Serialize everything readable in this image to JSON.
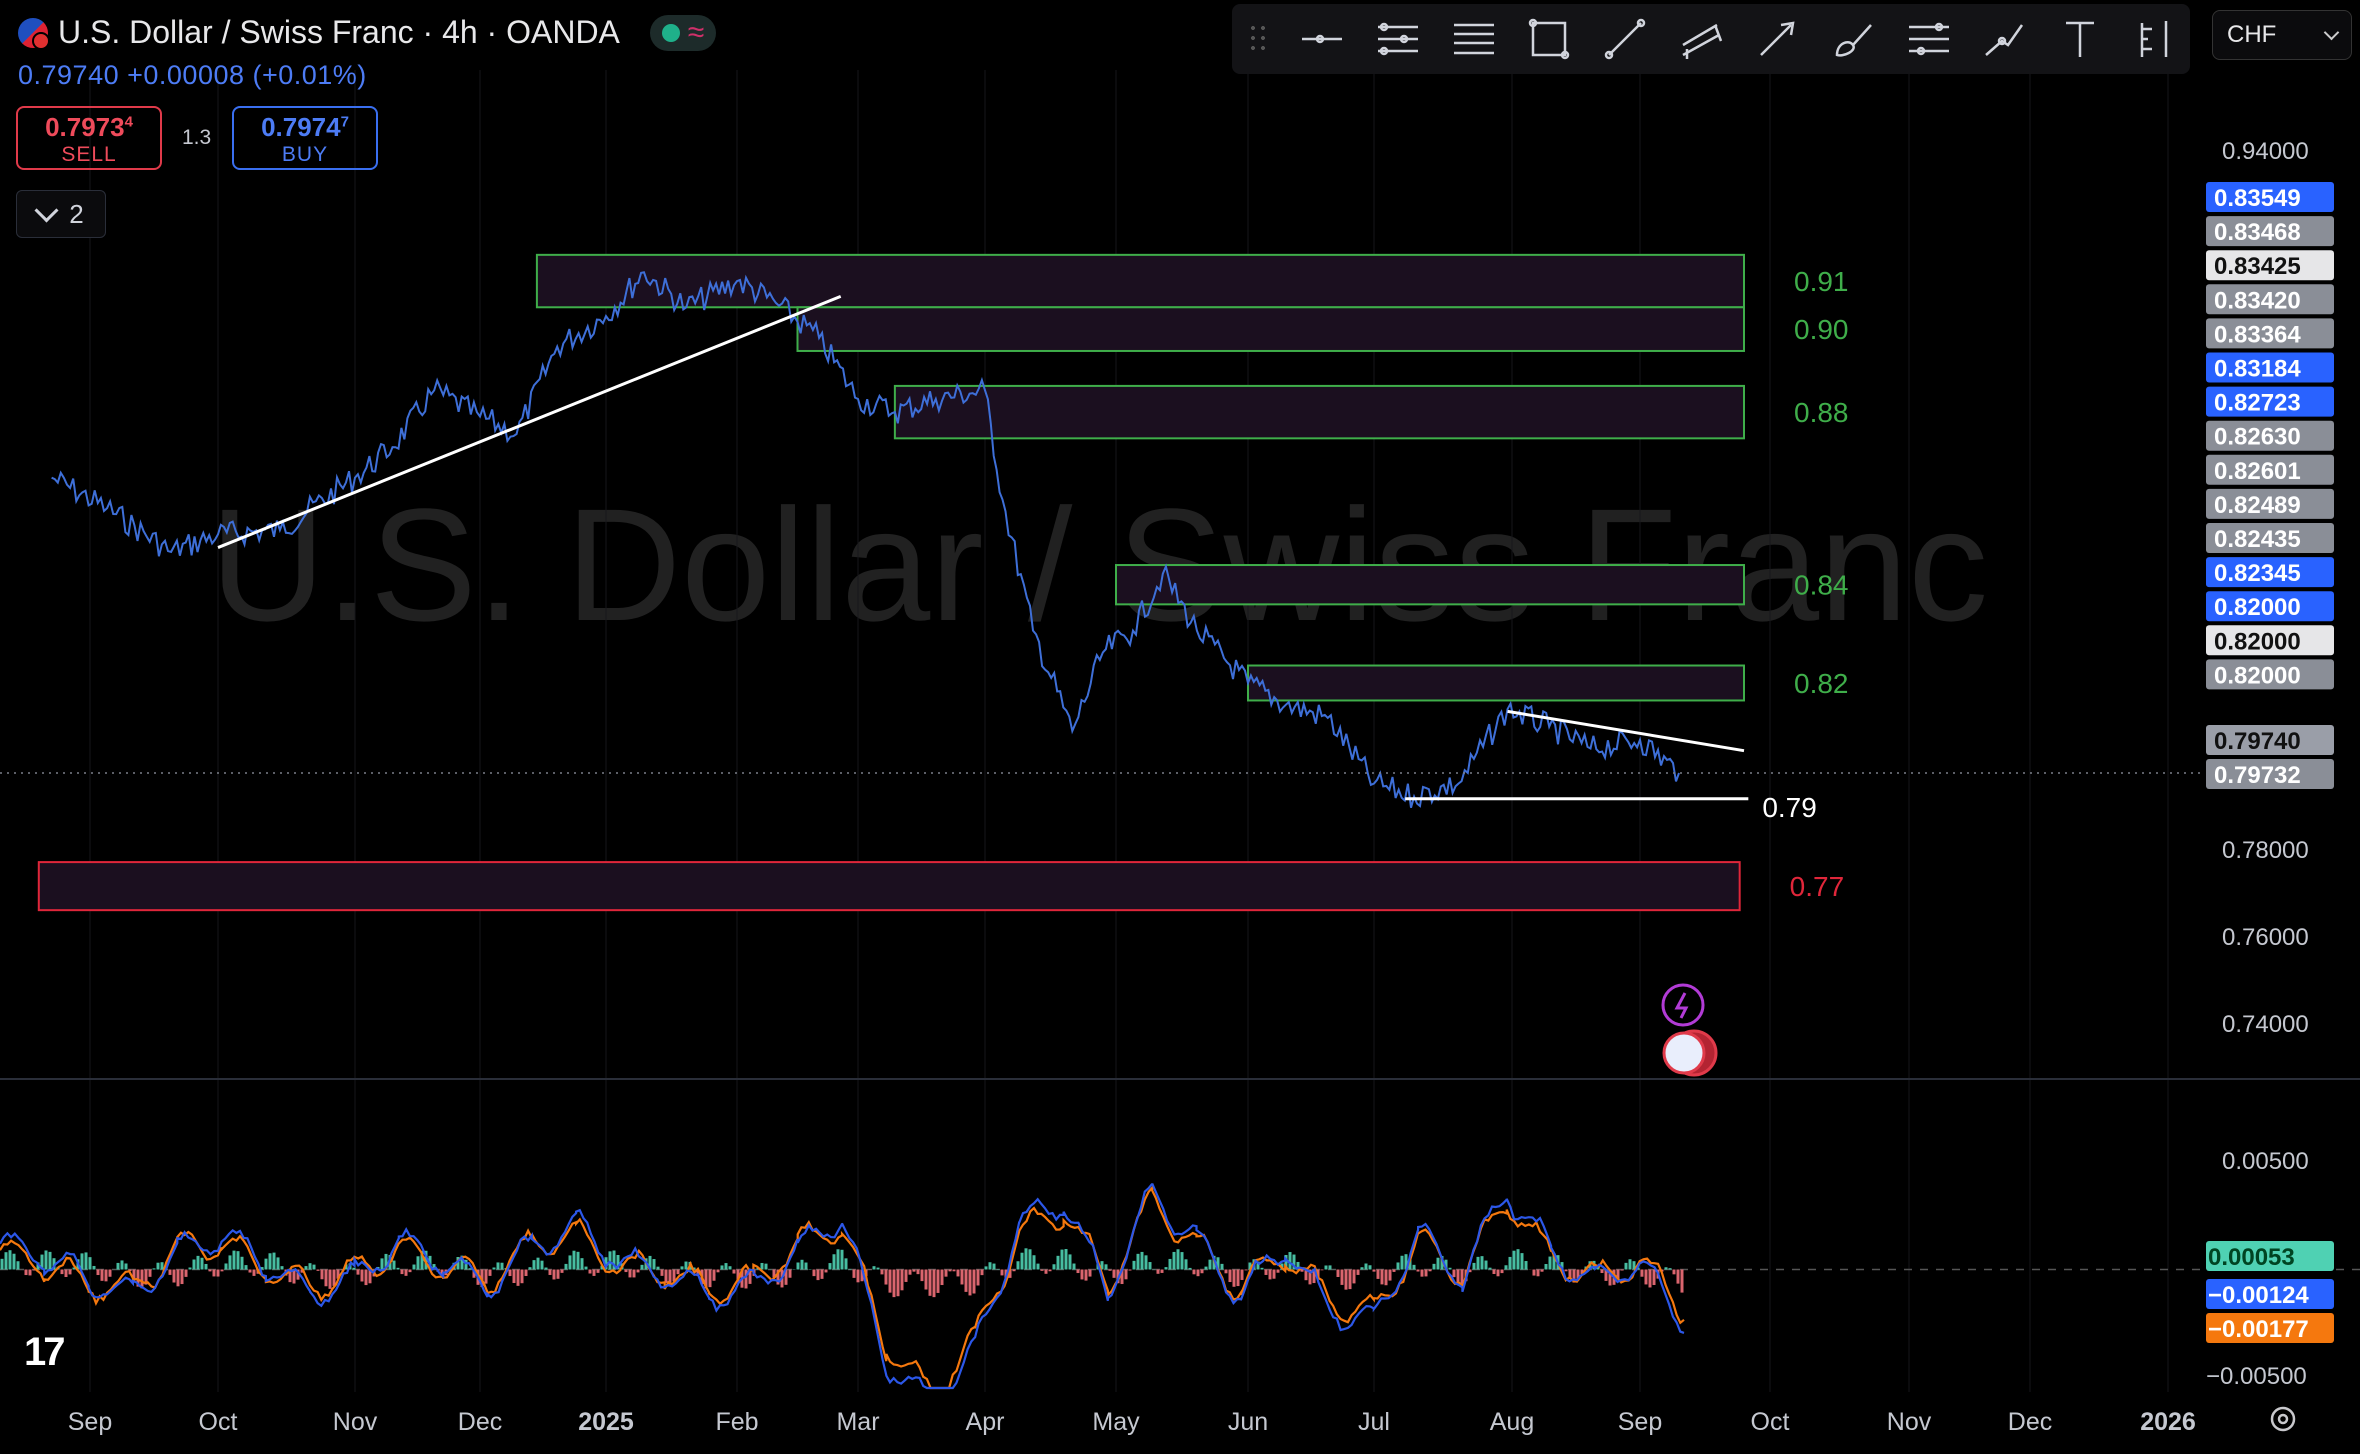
{
  "header": {
    "title": "U.S. Dollar / Swiss Franc · 4h · OANDA",
    "last_price": "0.79740",
    "change": "+0.00008 (+0.01%)",
    "sell_price": "0.7973",
    "sell_price_sup": "4",
    "sell_label": "SELL",
    "buy_price": "0.7974",
    "buy_price_sup": "7",
    "buy_label": "BUY",
    "spread": "1.3",
    "collapsed_count": "2"
  },
  "toolbar": {
    "tools": [
      "horizontal-ray-icon",
      "parallel-channel-icon",
      "fib-lines-icon",
      "rectangle-icon",
      "trend-line-icon",
      "pitchfork-icon",
      "arrow-icon",
      "brush-icon",
      "regression-icon",
      "path-icon",
      "text-icon",
      "long-position-icon"
    ],
    "currency": "CHF"
  },
  "watermark": "U.S. Dollar / Swiss Franc",
  "colors": {
    "background": "#000000",
    "price_line": "#3e6fd8",
    "zone_fill": "#1b0f1f",
    "zone_green": "#3fae4a",
    "zone_red": "#e0263a",
    "trendline": "#ffffff",
    "label_blue": "#2962ff",
    "label_gray": "#9a9ea8",
    "hist_pos": "#4fd1b3",
    "hist_neg": "#f2707a",
    "osc_blue": "#2c57e8",
    "osc_orange": "#f5780e"
  },
  "chart_data": [
    {
      "type": "line",
      "title": "U.S. Dollar / Swiss Franc · 4h · OANDA",
      "x_tick_labels": [
        "Sep",
        "Oct",
        "Nov",
        "Dec",
        "2025",
        "Feb",
        "Mar",
        "Apr",
        "May",
        "Jun",
        "Jul",
        "Aug",
        "Sep",
        "Oct",
        "Nov",
        "Dec",
        "2026"
      ],
      "ylim": [
        0.725,
        0.985
      ],
      "y_tick_labels": [
        "0.94000",
        "0.78000",
        "0.76000",
        "0.74000"
      ],
      "series": [
        {
          "x": [
            "2024-08-23",
            "2024-09-05",
            "2024-09-20",
            "2024-10-01",
            "2024-10-15",
            "2024-11-01",
            "2024-11-10",
            "2024-11-20",
            "2024-12-01",
            "2024-12-10",
            "2024-12-20",
            "2025-01-01",
            "2025-01-10",
            "2025-01-20",
            "2025-02-01",
            "2025-02-10",
            "2025-02-20",
            "2025-03-01",
            "2025-03-10",
            "2025-03-20",
            "2025-04-01",
            "2025-04-05",
            "2025-04-12",
            "2025-04-21",
            "2025-04-28",
            "2025-05-05",
            "2025-05-12",
            "2025-05-20",
            "2025-06-01",
            "2025-06-10",
            "2025-06-20",
            "2025-07-01",
            "2025-07-10",
            "2025-07-20",
            "2025-07-31",
            "2025-08-10",
            "2025-08-20",
            "2025-09-01",
            "2025-09-10"
          ],
          "values": [
            0.865,
            0.858,
            0.848,
            0.852,
            0.853,
            0.865,
            0.872,
            0.885,
            0.879,
            0.875,
            0.895,
            0.902,
            0.912,
            0.904,
            0.91,
            0.905,
            0.897,
            0.883,
            0.88,
            0.883,
            0.885,
            0.86,
            0.83,
            0.807,
            0.825,
            0.83,
            0.843,
            0.83,
            0.818,
            0.813,
            0.81,
            0.795,
            0.792,
            0.795,
            0.812,
            0.808,
            0.803,
            0.805,
            0.7974
          ]
        }
      ],
      "zones": [
        {
          "label": "0.91",
          "from": "2024-12-15",
          "to": "2025-09-25",
          "low": 0.904,
          "high": 0.916,
          "color": "green"
        },
        {
          "label": "0.90",
          "from": "2025-02-15",
          "to": "2025-09-25",
          "low": 0.894,
          "high": 0.904,
          "color": "green"
        },
        {
          "label": "0.88",
          "from": "2025-03-10",
          "to": "2025-09-25",
          "low": 0.874,
          "high": 0.886,
          "color": "green"
        },
        {
          "label": "0.84",
          "from": "2025-05-01",
          "to": "2025-09-25",
          "low": 0.836,
          "high": 0.845,
          "color": "green"
        },
        {
          "label": "0.82",
          "from": "2025-06-01",
          "to": "2025-09-25",
          "low": 0.814,
          "high": 0.822,
          "color": "green"
        },
        {
          "label": "0.77",
          "from": "2024-08-20",
          "to": "2025-09-24",
          "low": 0.766,
          "high": 0.777,
          "color": "red"
        }
      ],
      "lines": [
        {
          "from": [
            "2024-10-01",
            0.849
          ],
          "to": [
            "2025-02-25",
            0.9065
          ]
        },
        {
          "from": [
            "2025-07-31",
            0.8115
          ],
          "to": [
            "2025-09-25",
            0.8025
          ]
        },
        {
          "from": [
            "2025-07-08",
            0.7915
          ],
          "to": [
            "2025-09-26",
            0.7915
          ],
          "label": "0.79"
        }
      ],
      "price_labels": [
        {
          "value": "0.83549",
          "style": "blue"
        },
        {
          "value": "0.83468",
          "style": "gray"
        },
        {
          "value": "0.83425",
          "style": "light"
        },
        {
          "value": "0.83420",
          "style": "gray"
        },
        {
          "value": "0.83364",
          "style": "gray"
        },
        {
          "value": "0.83184",
          "style": "blue"
        },
        {
          "value": "0.82723",
          "style": "blue"
        },
        {
          "value": "0.82630",
          "style": "gray"
        },
        {
          "value": "0.82601",
          "style": "gray"
        },
        {
          "value": "0.82489",
          "style": "gray"
        },
        {
          "value": "0.82435",
          "style": "gray"
        },
        {
          "value": "0.82345",
          "style": "blue"
        },
        {
          "value": "0.82000",
          "style": "blue"
        },
        {
          "value": "0.82000",
          "style": "light"
        },
        {
          "value": "0.82000",
          "style": "gray"
        },
        {
          "value": "0.79740",
          "style": "gray"
        },
        {
          "value": "0.79732",
          "style": "gray"
        }
      ],
      "current_price": 0.7974
    },
    {
      "type": "line",
      "ylim": [
        -0.0075,
        0.0085
      ],
      "y_tick_labels": [
        "0.00500",
        "−0.00500"
      ],
      "series": [
        {
          "name": "blue",
          "values": [
            0.0012,
            0.0006,
            -0.0005,
            -0.0012,
            0.0008,
            0.0016,
            0.0003,
            -0.0011,
            -0.0004,
            0.0013,
            0.0004,
            -0.0008,
            0.0011,
            0.002,
            0.0004,
            -0.0002,
            -0.0012,
            -0.0008,
            0.0009,
            0.0025,
            -0.0042,
            -0.0065,
            -0.0038,
            0.0021,
            0.0032,
            -0.001,
            0.0036,
            0.0014,
            -0.0012,
            0.0011,
            -0.0018,
            -0.0024,
            0.0016,
            -0.0004,
            0.0037,
            0.0008,
            -0.0006,
            0.0003,
            -0.0025
          ]
        },
        {
          "name": "orange",
          "values": [
            0.0009,
            0.0003,
            -0.0007,
            -0.0009,
            0.001,
            0.0013,
            0,
            -0.0008,
            -0.0001,
            0.001,
            0.0001,
            -0.0005,
            0.0012,
            0.0017,
            0.0001,
            -0.0001,
            -0.0009,
            -0.0005,
            0.0011,
            0.0021,
            -0.0035,
            -0.0058,
            -0.0032,
            0.0017,
            0.0028,
            -0.0007,
            0.0032,
            0.0011,
            -0.0009,
            0.0008,
            -0.0014,
            -0.0021,
            0.0013,
            -0.0002,
            0.0033,
            0.0006,
            -0.0004,
            0.0004,
            -0.0018
          ]
        }
      ],
      "last_values": [
        {
          "value": "0.00053",
          "style": "teal"
        },
        {
          "value": "−0.00124",
          "style": "blue"
        },
        {
          "value": "−0.00177",
          "style": "orange"
        }
      ]
    }
  ]
}
